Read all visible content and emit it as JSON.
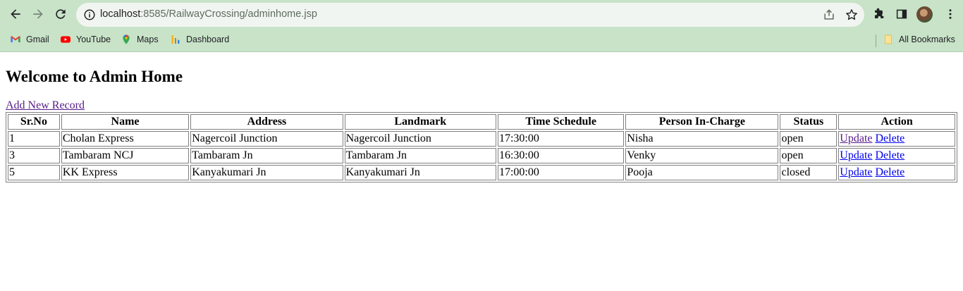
{
  "browser": {
    "url_host": "localhost",
    "url_rest": ":8585/RailwayCrossing/adminhome.jsp",
    "bookmarks": [
      {
        "label": "Gmail",
        "icon": "gmail-icon"
      },
      {
        "label": "YouTube",
        "icon": "youtube-icon"
      },
      {
        "label": "Maps",
        "icon": "maps-icon"
      },
      {
        "label": "Dashboard",
        "icon": "dashboard-icon"
      }
    ],
    "all_bookmarks_label": "All Bookmarks"
  },
  "page": {
    "title": "Welcome to Admin Home",
    "add_link": "Add New Record"
  },
  "table": {
    "headers": [
      "Sr.No",
      "Name",
      "Address",
      "Landmark",
      "Time Schedule",
      "Person In-Charge",
      "Status",
      "Action"
    ],
    "rows": [
      {
        "srno": "1",
        "name": "Cholan Express",
        "address": "Nagercoil Junction",
        "landmark": "Nagercoil Junction",
        "time": "17:30:00",
        "person": "Nisha",
        "status": "open"
      },
      {
        "srno": "3",
        "name": "Tambaram NCJ",
        "address": "Tambaram Jn",
        "landmark": "Tambaram Jn",
        "time": "16:30:00",
        "person": "Venky",
        "status": "open"
      },
      {
        "srno": "5",
        "name": "KK Express",
        "address": "Kanyakumari Jn",
        "landmark": "Kanyakumari Jn",
        "time": "17:00:00",
        "person": "Pooja",
        "status": "closed"
      }
    ],
    "update_label": "Update",
    "delete_label": "Delete"
  },
  "colors": {
    "chrome_bg": "#c8e3c8",
    "link_visited": "#551a8b",
    "link": "#0000ee"
  }
}
